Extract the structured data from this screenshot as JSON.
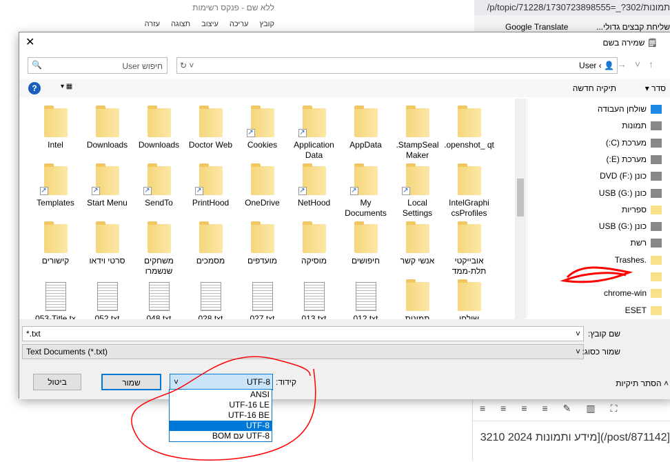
{
  "notepad": {
    "title": "ללא שם - פנקס רשימות",
    "menu": [
      "קובץ",
      "עריכה",
      "עיצוב",
      "תצוגה",
      "עזרה"
    ]
  },
  "browser": {
    "url": "תמונות/p/topic/71228/1730723898555=_?302/",
    "bookmarks": [
      "שליחת קבצים גדולי...",
      "Google Translate",
      "הו"
    ],
    "editor_text": "[post/871142/)[מידע ותמונות 2024 3210"
  },
  "dialog": {
    "title": "שמירה בשם",
    "address": {
      "path": "User",
      "search_placeholder": "חיפוש User"
    },
    "toolbar": {
      "organize": "סדר",
      "new_folder": "תיקיה חדשה"
    },
    "items": [
      {
        "name": "Intel",
        "type": "folder"
      },
      {
        "name": "Downloads",
        "type": "folder"
      },
      {
        "name": "Downloads",
        "type": "folder"
      },
      {
        "name": "Doctor Web",
        "type": "folder"
      },
      {
        "name": "Cookies",
        "type": "shortcut"
      },
      {
        "name": "Application Data",
        "type": "shortcut"
      },
      {
        "name": "AppData",
        "type": "folder"
      },
      {
        "name": ".StampSeal Maker",
        "type": "folder"
      },
      {
        "name": ".openshot_ qt",
        "type": "folder"
      },
      {
        "name": "Templates",
        "type": "shortcut"
      },
      {
        "name": "Start Menu",
        "type": "shortcut"
      },
      {
        "name": "SendTo",
        "type": "shortcut"
      },
      {
        "name": "PrintHood",
        "type": "shortcut"
      },
      {
        "name": "OneDrive",
        "type": "folder"
      },
      {
        "name": "NetHood",
        "type": "shortcut"
      },
      {
        "name": "My Documents",
        "type": "shortcut"
      },
      {
        "name": "Local Settings",
        "type": "shortcut"
      },
      {
        "name": "IntelGraphi csProfiles",
        "type": "folder"
      },
      {
        "name": "קישורים",
        "type": "folder"
      },
      {
        "name": "סרטי וידאו",
        "type": "folder"
      },
      {
        "name": "משחקים שנשמרו",
        "type": "folder"
      },
      {
        "name": "מסמכים",
        "type": "folder"
      },
      {
        "name": "מועדפים",
        "type": "folder"
      },
      {
        "name": "מוסיקה",
        "type": "folder"
      },
      {
        "name": "חיפושים",
        "type": "folder"
      },
      {
        "name": "אנשי קשר",
        "type": "folder"
      },
      {
        "name": "אובייקטי תלת-ממד",
        "type": "folder"
      },
      {
        "name": "053-Title.tx",
        "type": "doc"
      },
      {
        "name": "052.txt",
        "type": "doc"
      },
      {
        "name": "048.txt",
        "type": "doc"
      },
      {
        "name": "028.txt",
        "type": "doc"
      },
      {
        "name": "027.txt",
        "type": "doc"
      },
      {
        "name": "013.txt",
        "type": "doc"
      },
      {
        "name": "012.txt",
        "type": "doc"
      },
      {
        "name": "תמונות",
        "type": "folder"
      },
      {
        "name": "שולחן",
        "type": "folder"
      }
    ],
    "nav": [
      "שולחן העבודה",
      "תמונות",
      "מערכת (C:)",
      "מערכת (E:)",
      "כונן DVD (F:)",
      "כונן USB (G:)",
      "ספריות",
      "כונן USB (G:)",
      "רשת",
      ".Trashes",
      "",
      "chrome-win",
      "ESET"
    ],
    "filename_label": "שם קובץ:",
    "filename_value": "*.txt",
    "type_label": "שמור כסוג:",
    "type_value": "Text Documents (*.txt)",
    "encoding_label": "קידוד:",
    "encoding_value": "UTF-8",
    "encoding_options": [
      "ANSI",
      "UTF-16 LE",
      "UTF-16 BE",
      "UTF-8",
      "UTF-8 עם BOM"
    ],
    "encoding_selected": "UTF-8",
    "save": "שמור",
    "cancel": "ביטול",
    "hide_folders": "הסתר תיקיות"
  },
  "colors": {
    "accent": "#0078d7",
    "annotation": "#ff0000"
  }
}
